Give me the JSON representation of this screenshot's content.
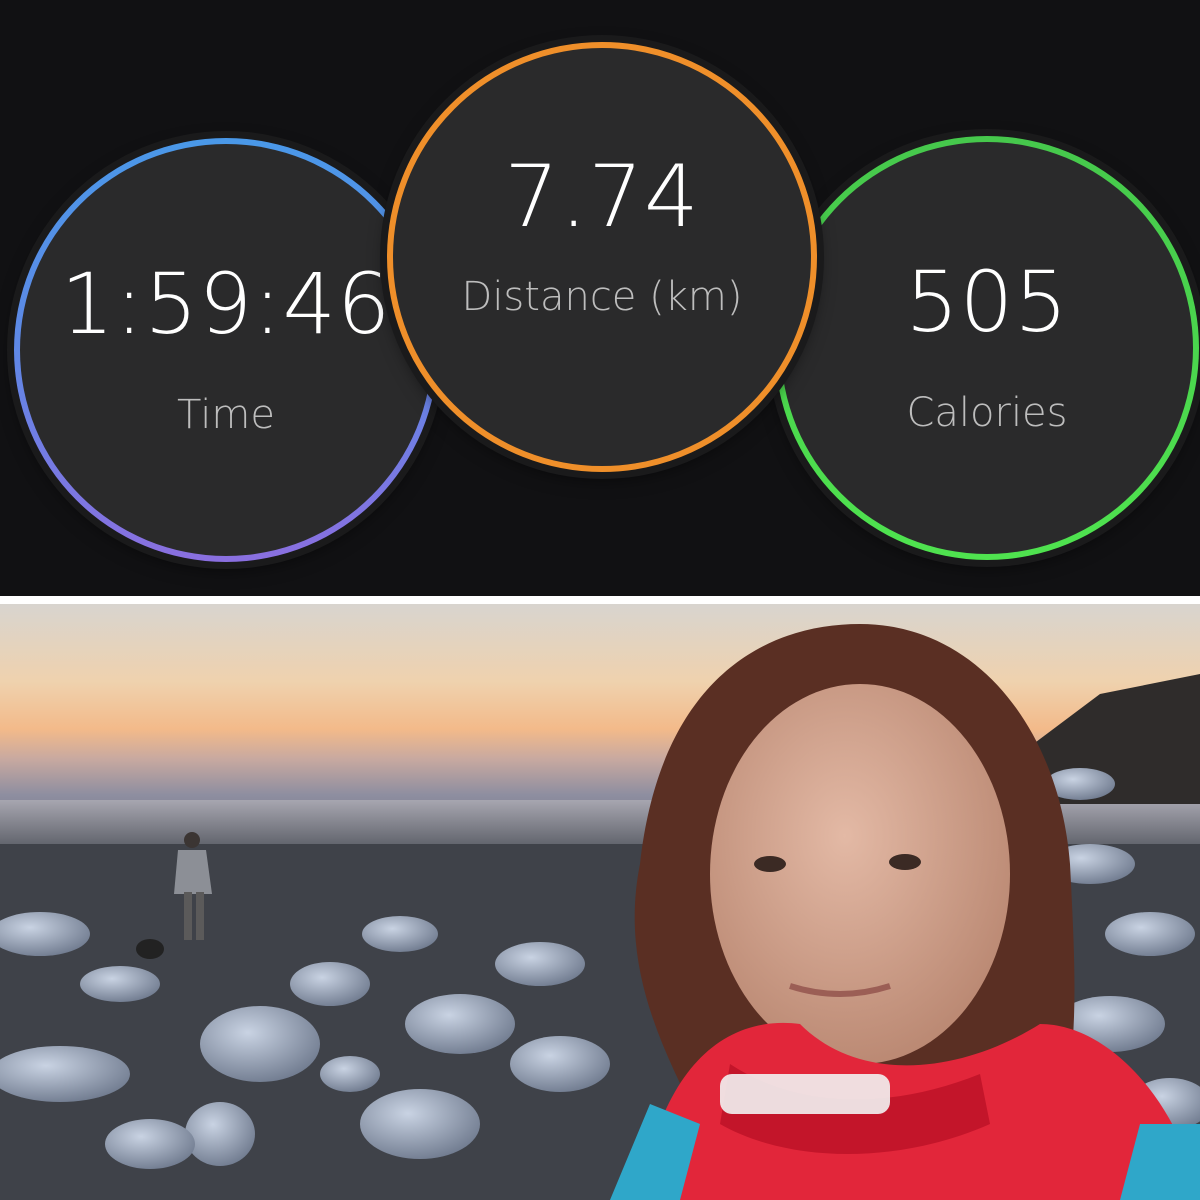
{
  "stats": {
    "time": {
      "value": "1:59:46",
      "label": "Time",
      "color": "#4a98e8"
    },
    "distance": {
      "value": "7.74",
      "label": "Distance (km)",
      "color": "#ef8f2a"
    },
    "calories": {
      "value": "505",
      "label": "Calories",
      "color": "#4fe34f"
    }
  },
  "photo": {
    "description_colors": {
      "sky": "#f3ba8a",
      "sea": "#8e8ea0",
      "rocks": "#9ca7bb",
      "jacket": "#e2263a"
    }
  }
}
